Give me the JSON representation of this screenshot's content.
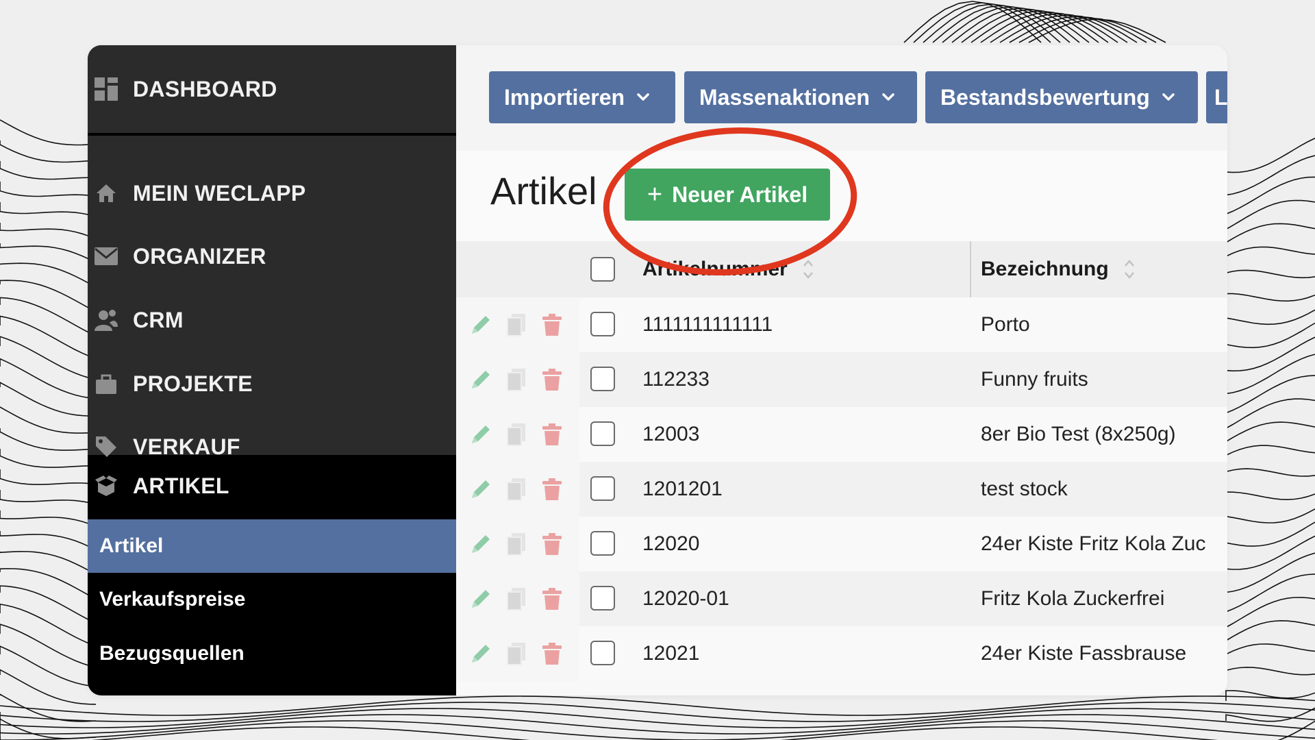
{
  "sidebar": {
    "dashboard": "DASHBOARD",
    "items": [
      {
        "label": "MEIN WECLAPP",
        "icon": "home-icon"
      },
      {
        "label": "ORGANIZER",
        "icon": "envelope-icon"
      },
      {
        "label": "CRM",
        "icon": "users-icon"
      },
      {
        "label": "PROJEKTE",
        "icon": "briefcase-icon"
      },
      {
        "label": "VERKAUF",
        "icon": "tag-icon"
      }
    ],
    "section": {
      "label": "ARTIKEL",
      "icon": "box-icon"
    },
    "subitems": [
      {
        "label": "Artikel",
        "active": true
      },
      {
        "label": "Verkaufspreise",
        "active": false
      },
      {
        "label": "Bezugsquellen",
        "active": false
      }
    ]
  },
  "toolbar": {
    "import_label": "Importieren",
    "bulk_label": "Massenaktionen",
    "valuation_label": "Bestandsbewertung",
    "cut_label": "L"
  },
  "page": {
    "title": "Artikel",
    "new_button": "Neuer Artikel"
  },
  "table": {
    "headers": {
      "number": "Artikelnummer",
      "name": "Bezeichnung"
    },
    "rows": [
      {
        "number": "1111111111111",
        "name": "Porto"
      },
      {
        "number": "112233",
        "name": "Funny fruits"
      },
      {
        "number": "12003",
        "name": "8er Bio Test (8x250g)"
      },
      {
        "number": "1201201",
        "name": "test stock"
      },
      {
        "number": "12020",
        "name": "24er Kiste Fritz Kola Zuc"
      },
      {
        "number": "12020-01",
        "name": "Fritz Kola Zuckerfrei"
      },
      {
        "number": "12021",
        "name": "24er Kiste Fassbrause"
      }
    ]
  },
  "colors": {
    "sidebar_bg": "#2b2b2b",
    "sidebar_active_bg": "#000000",
    "accent_blue": "#5470a0",
    "button_green": "#41a55f",
    "highlight_red": "#e0371f",
    "edit_icon": "#8fcca8",
    "delete_icon": "#eba1a1"
  }
}
